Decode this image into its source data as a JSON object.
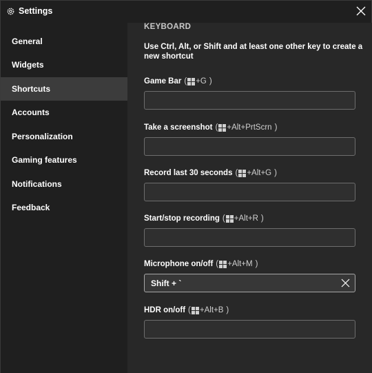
{
  "window": {
    "title": "Settings",
    "icons": {
      "app": "gear-icon",
      "close": "close-icon"
    }
  },
  "sidebar": {
    "items": [
      {
        "label": "General"
      },
      {
        "label": "Widgets"
      },
      {
        "label": "Shortcuts",
        "selected": true
      },
      {
        "label": "Accounts"
      },
      {
        "label": "Personalization"
      },
      {
        "label": "Gaming features"
      },
      {
        "label": "Notifications"
      },
      {
        "label": "Feedback"
      }
    ]
  },
  "content": {
    "section_title": "KEYBOARD",
    "description": "Use Ctrl, Alt, or Shift and at least one other key to create a new shortcut",
    "shortcuts": [
      {
        "label": "Game Bar",
        "hint_suffix": "+G",
        "value": ""
      },
      {
        "label": "Take a screenshot",
        "hint_suffix": "+Alt+PrtScrn",
        "value": ""
      },
      {
        "label": "Record last 30 seconds",
        "hint_suffix": "+Alt+G",
        "value": ""
      },
      {
        "label": "Start/stop recording",
        "hint_suffix": "+Alt+R",
        "value": ""
      },
      {
        "label": "Microphone on/off",
        "hint_suffix": "+Alt+M",
        "value": "Shift + `"
      },
      {
        "label": "HDR on/off",
        "hint_suffix": "+Alt+B",
        "value": ""
      }
    ],
    "hint_open": "(",
    "hint_close": ")",
    "windows_key_icon": "windows-key-icon",
    "clear_icon": "clear-x-icon"
  },
  "colors": {
    "sidebar_bg": "#1f1f1f",
    "content_bg": "#282828",
    "selected_bg": "#3c3c3c",
    "input_border": "#6e6e6e"
  }
}
